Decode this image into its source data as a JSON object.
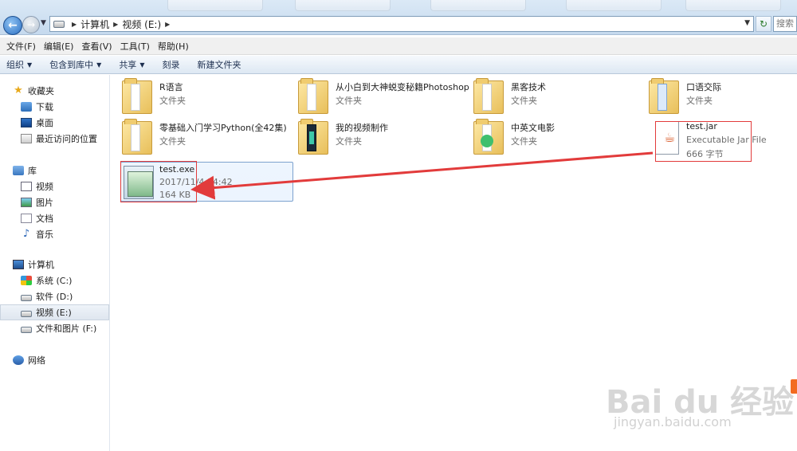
{
  "address": {
    "crumbs": [
      "计算机",
      "视频 (E:)"
    ],
    "search_placeholder": "搜索 视频"
  },
  "menu": [
    "文件(F)",
    "编辑(E)",
    "查看(V)",
    "工具(T)",
    "帮助(H)"
  ],
  "commands": [
    {
      "label": "组织",
      "caret": true
    },
    {
      "label": "包含到库中",
      "caret": true
    },
    {
      "label": "共享",
      "caret": true
    },
    {
      "label": "刻录",
      "caret": false
    },
    {
      "label": "新建文件夹",
      "caret": false
    }
  ],
  "sidebar": {
    "favorites": "收藏夹",
    "downloads": "下载",
    "desktop": "桌面",
    "recent": "最近访问的位置",
    "libraries": "库",
    "videos": "视频",
    "pictures": "图片",
    "documents": "文档",
    "music": "音乐",
    "computer": "计算机",
    "drive_c": "系统 (C:)",
    "drive_d": "软件 (D:)",
    "drive_e": "视频 (E:)",
    "drive_f": "文件和图片 (F:)",
    "network": "网络"
  },
  "items": [
    {
      "name": "R语言",
      "sub": "文件夹"
    },
    {
      "name": "从小白到大神蜕变秘籍Photoshop",
      "sub": "文件夹"
    },
    {
      "name": "黑客技术",
      "sub": "文件夹"
    },
    {
      "name": "口语交际",
      "sub": "文件夹"
    },
    {
      "name": "零基础入门学习Python(全42集)",
      "sub": "文件夹"
    },
    {
      "name": "我的视频制作",
      "sub": "文件夹"
    },
    {
      "name": "中英文电影",
      "sub": "文件夹"
    },
    {
      "name": "test.jar",
      "sub": "Executable Jar File",
      "sub2": "666 字节"
    },
    {
      "name": "test.exe",
      "sub": "2017/11/4 14:42",
      "sub2": "164 KB"
    }
  ],
  "watermark": {
    "brand": "Bai du 经验",
    "url": "jingyan.baidu.com"
  },
  "colors": {
    "annotation": "#e23b3b",
    "selection": "#7da2ce"
  }
}
